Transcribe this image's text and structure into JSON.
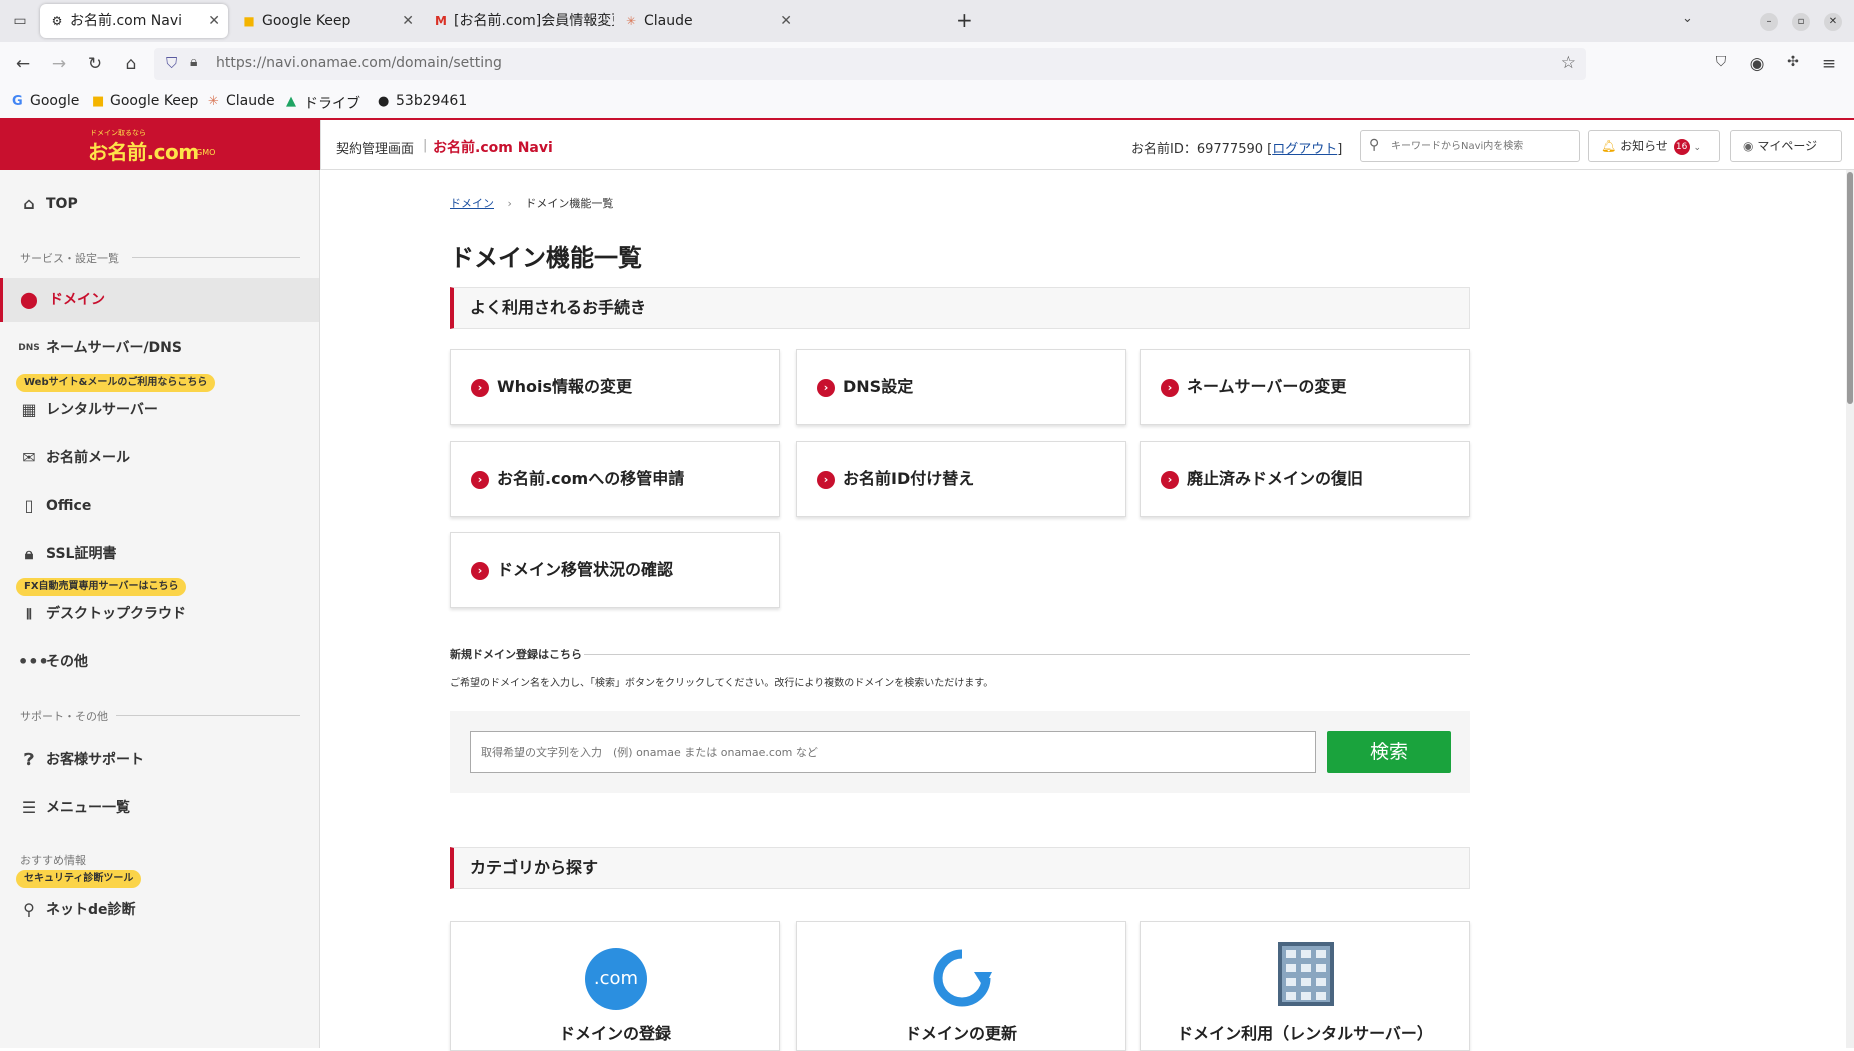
{
  "browser": {
    "tabs": [
      {
        "title": "お名前.com Navi",
        "favicon": "globe-icon",
        "active": true
      },
      {
        "title": "Google Keep",
        "favicon": "keep-icon",
        "active": false
      },
      {
        "title": "[お名前.com]会員情報変更",
        "favicon": "gmail-icon",
        "active": false
      },
      {
        "title": "Claude",
        "favicon": "claude-icon",
        "active": false
      }
    ],
    "url": "https://navi.onamae.com/domain/setting",
    "bookmarks": [
      {
        "label": "Google",
        "icon": "G"
      },
      {
        "label": "Google Keep",
        "icon": "■"
      },
      {
        "label": "Claude",
        "icon": "✳"
      },
      {
        "label": "ドライブ",
        "icon": "▲"
      },
      {
        "label": "53b29461",
        "icon": "●"
      }
    ]
  },
  "header": {
    "logo_tagline": "ドメイン取るなら",
    "logo_text": "お名前.com",
    "logo_gmo": "GMO",
    "contract_label": "契約管理画面",
    "pipe": "|",
    "navi_label": "お名前.com Navi",
    "id_text": "お名前ID：69777590 [",
    "logout_label": "ログアウト",
    "id_close": "]",
    "search_placeholder": "キーワードからNavi内を検索",
    "notice_label": "お知らせ",
    "notice_count": "16",
    "mypage_label": "マイページ"
  },
  "sidebar": {
    "top_label": "TOP",
    "section_services": "サービス・設定一覧",
    "domain_label": "ドメイン",
    "nameserver_label": "ネームサーバー/DNS",
    "web_tag": "Webサイト&メールのご利用ならこちら",
    "rental_label": "レンタルサーバー",
    "mail_label": "お名前メール",
    "office_label": "Office",
    "ssl_label": "SSL証明書",
    "fx_tag": "FX自動売買専用サーバーはこちら",
    "desktop_label": "デスクトップクラウド",
    "other_label": "その他",
    "section_support": "サポート・その他",
    "support_label": "お客様サポート",
    "menu_label": "メニュー一覧",
    "section_recommend": "おすすめ情報",
    "security_tag": "セキュリティ診断ツール",
    "netde_label": "ネットde診断"
  },
  "main": {
    "breadcrumb_root": "ドメイン",
    "breadcrumb_sep": "›",
    "breadcrumb_current": "ドメイン機能一覧",
    "title": "ドメイン機能一覧",
    "frequent_heading": "よく利用されるお手続き",
    "cards": [
      "Whois情報の変更",
      "DNS設定",
      "ネームサーバーの変更",
      "お名前.comへの移管申請",
      "お名前ID付け替え",
      "廃止済みドメインの復旧",
      "ドメイン移管状況の確認"
    ],
    "new_domain_title": "新規ドメイン登録はこちら",
    "new_domain_desc": "ご希望のドメイン名を入力し、「検索」ボタンをクリックしてください。改行により複数のドメインを検索いただけます。",
    "search_placeholder": "取得希望の文字列を入力　(例) onamae または onamae.com など",
    "search_button": "検索",
    "category_heading": "カテゴリから探す",
    "category_cards": [
      {
        "label": "ドメインの登録",
        "icon": "dotcom-icon",
        "icon_text": ".com"
      },
      {
        "label": "ドメインの更新",
        "icon": "refresh-icon"
      },
      {
        "label": "ドメイン利用（レンタルサーバー）",
        "icon": "server-building-icon"
      }
    ]
  },
  "colors": {
    "brand_red": "#c8102e",
    "logo_yellow": "#fde34a",
    "search_green": "#1aa33d",
    "tag_yellow": "#fbd449",
    "link_blue": "#1a4fa0"
  }
}
